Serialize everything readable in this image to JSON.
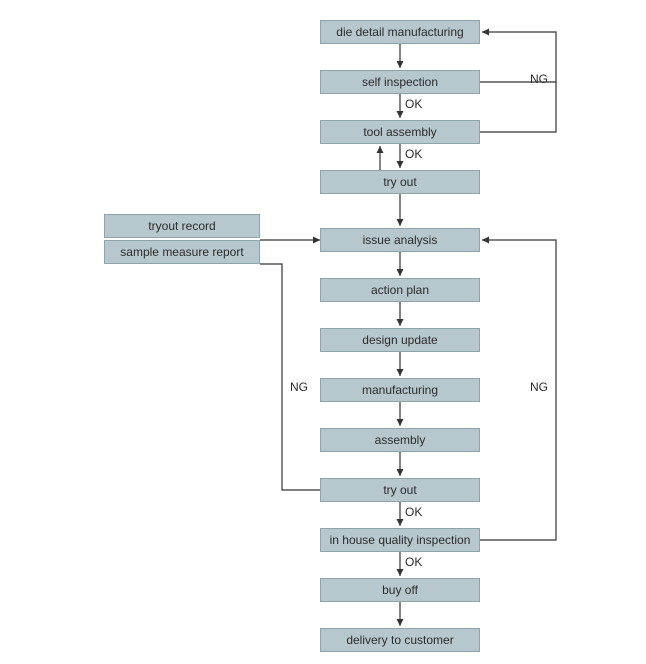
{
  "boxes": {
    "b1": "die detail manufacturing",
    "b2": "self inspection",
    "b3": "tool assembly",
    "b4": "try out",
    "b5": "issue analysis",
    "b6": "action plan",
    "b7": "design update",
    "b8": "manufacturing",
    "b9": "assembly",
    "b10": "try out",
    "b11": "in house quality inspection",
    "b12": "buy off",
    "b13": "delivery to customer",
    "side1": "tryout  record",
    "side2": "sample measure report"
  },
  "labels": {
    "ok1": "OK",
    "ok2": "OK",
    "ok3": "OK",
    "ok4": "OK",
    "ng1": "NG",
    "ng2": "NG",
    "ng3": "NG"
  },
  "colors": {
    "boxFill": "#b6c8ce",
    "boxBorder": "#8fa3aa",
    "arrow": "#333333"
  },
  "chart_data": {
    "type": "flowchart",
    "nodes": [
      {
        "id": "b1",
        "label": "die detail manufacturing"
      },
      {
        "id": "b2",
        "label": "self inspection"
      },
      {
        "id": "b3",
        "label": "tool assembly"
      },
      {
        "id": "b4",
        "label": "try out"
      },
      {
        "id": "b5",
        "label": "issue analysis"
      },
      {
        "id": "b6",
        "label": "action plan"
      },
      {
        "id": "b7",
        "label": "design update"
      },
      {
        "id": "b8",
        "label": "manufacturing"
      },
      {
        "id": "b9",
        "label": "assembly"
      },
      {
        "id": "b10",
        "label": "try out"
      },
      {
        "id": "b11",
        "label": "in house quality inspection"
      },
      {
        "id": "b12",
        "label": "buy off"
      },
      {
        "id": "b13",
        "label": "delivery to customer"
      },
      {
        "id": "side1",
        "label": "tryout record"
      },
      {
        "id": "side2",
        "label": "sample measure report"
      }
    ],
    "edges": [
      {
        "from": "b1",
        "to": "b2"
      },
      {
        "from": "b2",
        "to": "b3",
        "label": "OK"
      },
      {
        "from": "b2",
        "to": "b1",
        "label": "NG"
      },
      {
        "from": "b3",
        "to": "b4",
        "label": "OK"
      },
      {
        "from": "b4",
        "to": "b3"
      },
      {
        "from": "b4",
        "to": "b5"
      },
      {
        "from": "side1",
        "to": "b5"
      },
      {
        "from": "side2",
        "to": "b5"
      },
      {
        "from": "b5",
        "to": "b6"
      },
      {
        "from": "b6",
        "to": "b7"
      },
      {
        "from": "b7",
        "to": "b8"
      },
      {
        "from": "b8",
        "to": "b9"
      },
      {
        "from": "b9",
        "to": "b10"
      },
      {
        "from": "b10",
        "to": "b11",
        "label": "OK"
      },
      {
        "from": "b10",
        "to": "b5",
        "label": "NG",
        "note": "left loop"
      },
      {
        "from": "b11",
        "to": "b12",
        "label": "OK"
      },
      {
        "from": "b11",
        "to": "b5",
        "label": "NG",
        "note": "right loop"
      },
      {
        "from": "b3",
        "to": "b1",
        "label": "NG",
        "note": "right loop shared"
      }
    ]
  }
}
